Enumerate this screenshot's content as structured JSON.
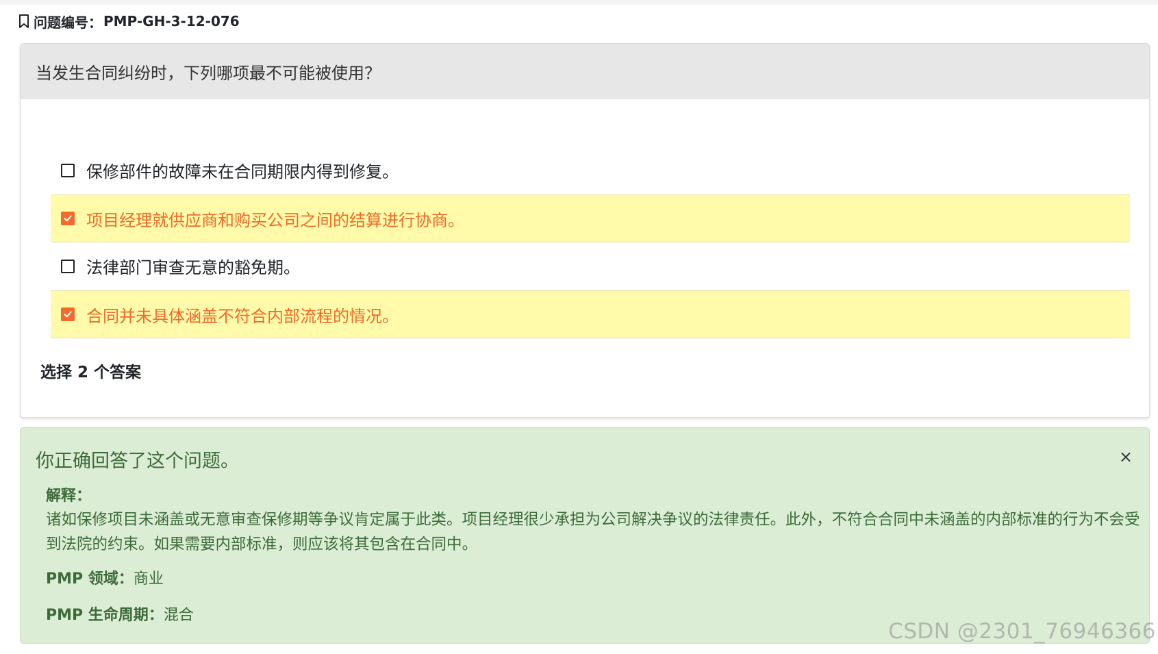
{
  "question": {
    "id_label": "问题编号：",
    "id_value": "PMP-GH-3-12-076",
    "text": "当发生合同纠纷时，下列哪项最不可能被使用？",
    "options": [
      {
        "label": "保修部件的故障未在合同期限内得到修复。",
        "selected": false
      },
      {
        "label": "项目经理就供应商和购买公司之间的结算进行协商。",
        "selected": true
      },
      {
        "label": "法律部门审查无意的豁免期。",
        "selected": false
      },
      {
        "label": "合同并未具体涵盖不符合内部流程的情况。",
        "selected": true
      }
    ],
    "select_hint": "选择 2 个答案"
  },
  "result": {
    "title": "你正确回答了这个问题。",
    "close_symbol": "×",
    "explanation_label": "解释：",
    "explanation_text": "诸如保修项目未涵盖或无意审查保修期等争议肯定属于此类。项目经理很少承担为公司解决争议的法律责任。此外，不符合合同中未涵盖的内部标准的行为不会受到法院的约束。如果需要内部标准，则应该将其包含在合同中。",
    "domain_label": "PMP 领域：",
    "domain_value": "商业",
    "lifecycle_label": "PMP 生命周期：",
    "lifecycle_value": "混合"
  },
  "watermark": "CSDN @2301_76946366",
  "colors": {
    "selected_bg": "#fffbaa",
    "selected_text": "#f06a2a",
    "success_bg": "#dcedd5",
    "success_text": "#3c6b3a"
  }
}
